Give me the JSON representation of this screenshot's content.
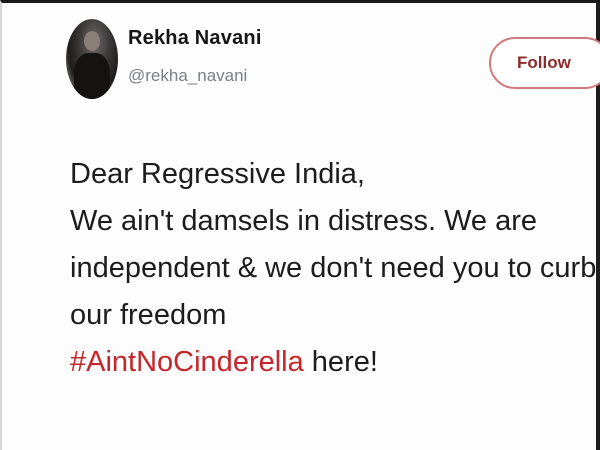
{
  "user": {
    "display_name": "Rekha Navani",
    "handle": "@rekha_navani"
  },
  "follow_button": {
    "label": "Follow"
  },
  "tweet": {
    "lines": [
      "Dear Regressive India,",
      "We ain't damsels in distress. We are",
      "independent & we don't need you to curb",
      "our freedom"
    ],
    "hashtag": "#AintNoCinderella",
    "hashtag_suffix": " here!"
  },
  "colors": {
    "hashtag": "#c4262b",
    "follow_border": "#d07a78",
    "follow_text": "#8b2c2a",
    "handle": "#7b7f84"
  }
}
